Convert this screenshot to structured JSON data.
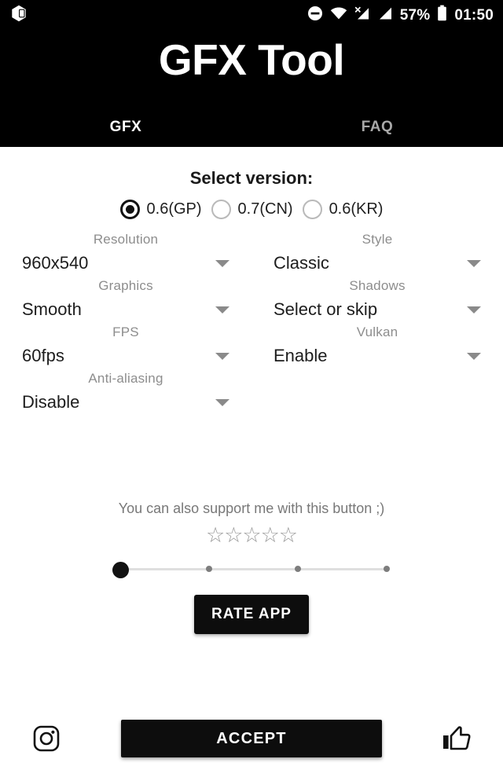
{
  "status_bar": {
    "notification_icon": "app-hexagon-icon",
    "dnd_icon": "do-not-disturb-icon",
    "wifi_icon": "wifi-icon",
    "sim_missing_icon": "cellular-no-sim-icon",
    "signal_icon": "cellular-signal-icon",
    "battery_percent": "57%",
    "battery_icon": "battery-icon",
    "clock": "01:50"
  },
  "header": {
    "title": "GFX Tool",
    "tabs": [
      {
        "label": "GFX",
        "active": true
      },
      {
        "label": "FAQ",
        "active": false
      }
    ]
  },
  "version": {
    "title": "Select version:",
    "options": [
      {
        "label": "0.6(GP)",
        "selected": true
      },
      {
        "label": "0.7(CN)",
        "selected": false
      },
      {
        "label": "0.6(KR)",
        "selected": false
      }
    ]
  },
  "settings": [
    {
      "label": "Resolution",
      "value": "960x540"
    },
    {
      "label": "Style",
      "value": "Classic"
    },
    {
      "label": "Graphics",
      "value": "Smooth"
    },
    {
      "label": "Shadows",
      "value": "Select or skip"
    },
    {
      "label": "FPS",
      "value": "60fps"
    },
    {
      "label": "Vulkan",
      "value": "Enable"
    },
    {
      "label": "Anti-aliasing",
      "value": "Disable"
    }
  ],
  "support": {
    "text": "You can also support me with this button ;)",
    "stars": "☆☆☆☆☆",
    "star_count": 5,
    "slider": {
      "value": 0,
      "min": 0,
      "max": 3,
      "ticks": 4
    },
    "rate_button": "RATE APP"
  },
  "bottom_bar": {
    "instagram_icon": "instagram-icon",
    "accept_button": "ACCEPT",
    "thumbs_up_icon": "thumbs-up-icon"
  },
  "colors": {
    "header_bg": "#000000",
    "content_bg": "#ffffff",
    "accent": "#0d0d0d",
    "muted_label": "#8d8d8d",
    "inactive_tab": "#a8a8a8"
  }
}
